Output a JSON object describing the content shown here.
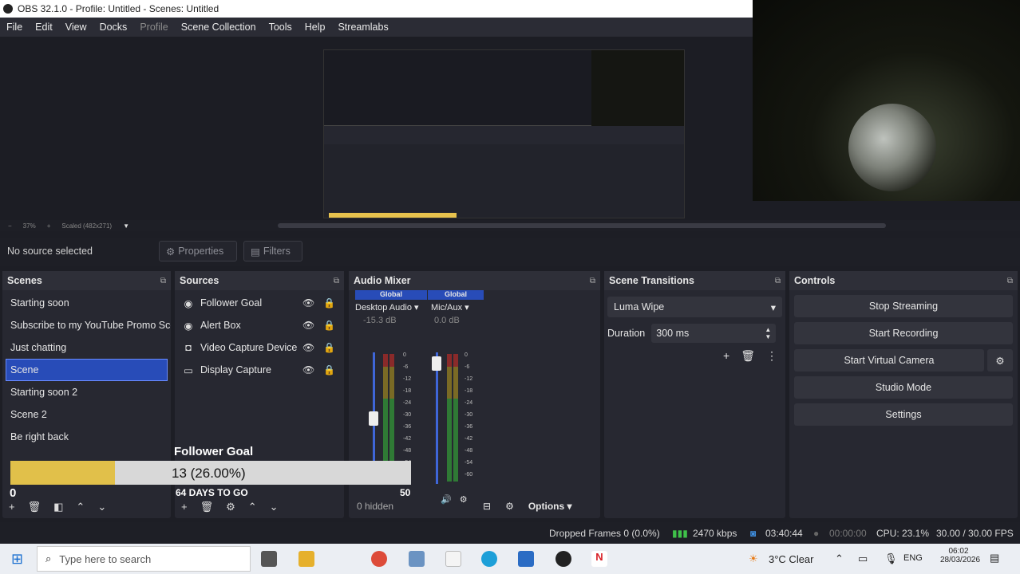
{
  "window": {
    "title": "OBS 32.1.0 - Profile: Untitled - Scenes: Untitled"
  },
  "menu": [
    {
      "label": "File"
    },
    {
      "label": "Edit"
    },
    {
      "label": "View"
    },
    {
      "label": "Docks"
    },
    {
      "label": "Profile",
      "disabled": true
    },
    {
      "label": "Scene Collection"
    },
    {
      "label": "Tools"
    },
    {
      "label": "Help"
    },
    {
      "label": "Streamlabs"
    }
  ],
  "preview": {
    "zoom": "37%",
    "scale_label": "Scaled (482x271)"
  },
  "source_bar": {
    "status": "No source selected",
    "properties_label": "Properties",
    "filters_label": "Filters"
  },
  "scenes": {
    "title": "Scenes",
    "items": [
      {
        "label": "Starting soon"
      },
      {
        "label": "Subscribe to my YouTube Promo Scene"
      },
      {
        "label": "Just chatting"
      },
      {
        "label": "Scene",
        "selected": true
      },
      {
        "label": "Starting soon 2"
      },
      {
        "label": "Scene 2"
      },
      {
        "label": "Be right back"
      }
    ]
  },
  "sources": {
    "title": "Sources",
    "items": [
      {
        "label": "Follower Goal",
        "icon": "browser-icon"
      },
      {
        "label": "Alert Box",
        "icon": "browser-icon"
      },
      {
        "label": "Video Capture Device",
        "icon": "camera-icon"
      },
      {
        "label": "Display Capture",
        "icon": "monitor-icon"
      }
    ]
  },
  "audio_mixer": {
    "title": "Audio Mixer",
    "channels": [
      {
        "tag": "Global",
        "name": "Desktop Audio",
        "db": "-15.3 dB",
        "fader_level": 0.55
      },
      {
        "tag": "Global",
        "name": "Mic/Aux",
        "db": "0.0 dB",
        "fader_level": 0.97
      }
    ],
    "scale": [
      "0",
      "-6",
      "-12",
      "-18",
      "-24",
      "-30",
      "-36",
      "-42",
      "-48",
      "-54",
      "-60"
    ],
    "hidden_label": "0 hidden",
    "options_label": "Options"
  },
  "transitions": {
    "title": "Scene Transitions",
    "selected": "Luma Wipe",
    "duration_label": "Duration",
    "duration_value": "300 ms"
  },
  "controls": {
    "title": "Controls",
    "stop_streaming": "Stop Streaming",
    "start_recording": "Start Recording",
    "start_virtual_camera": "Start Virtual Camera",
    "studio_mode": "Studio Mode",
    "settings": "Settings"
  },
  "follower_goal": {
    "title": "Follower Goal",
    "progress_label": "13 (26.00%)",
    "progress": 0.26,
    "min_label": "0",
    "days_left": "64 DAYS TO GO",
    "max_label": "50"
  },
  "status": {
    "dropped_frames": "Dropped Frames 0 (0.0%)",
    "bitrate": "2470 kbps",
    "stream_time": "03:40:44",
    "record_time": "00:00:00",
    "cpu": "CPU: 23.1%",
    "fps": "30.00 / 30.00 FPS"
  },
  "taskbar": {
    "search_placeholder": "Type here to search",
    "weather": "3°C  Clear",
    "lang": "ENG",
    "time": "06:02",
    "date": "28/03/2026"
  },
  "colors": {
    "selection": "#284cb8",
    "goal_fill": "#e1c04a",
    "dock_bg": "#272831"
  }
}
